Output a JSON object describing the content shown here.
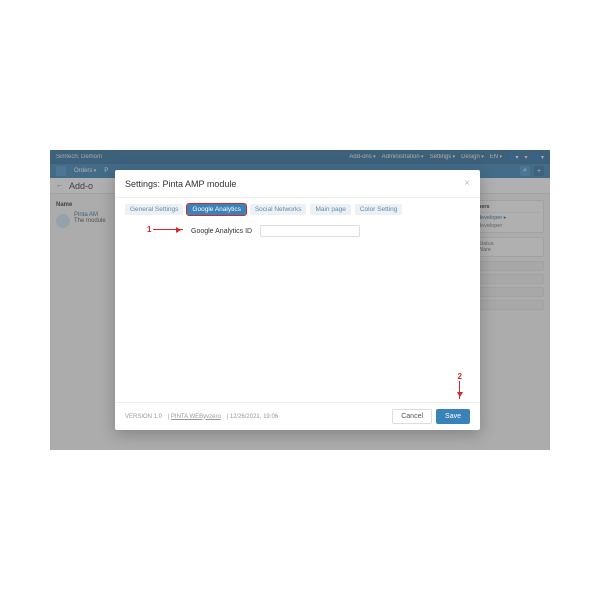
{
  "topbar": {
    "brand": "Simtech: Demo/n",
    "menu": [
      "Add-ons",
      "Administration",
      "Settings",
      "Design",
      "EN"
    ]
  },
  "subbar": {
    "items": [
      "Orders",
      "P"
    ],
    "search_icon": "search-icon",
    "plus_icon": "plus-icon"
  },
  "crumb": {
    "back": "←",
    "title": "Add-o"
  },
  "leftcol": {
    "header": "Name",
    "item_title": "Pinta AM",
    "item_desc": "The module"
  },
  "sidebar": {
    "title": "pers",
    "dev": "developer",
    "st": "Status",
    "w": "Ware"
  },
  "modal": {
    "title": "Settings: Pinta AMP module",
    "close": "×",
    "tabs": [
      "General Settings",
      "Google Analytics",
      "Social Networks",
      "Main page",
      "Color Setting"
    ],
    "active_tab": 1,
    "field_label": "Google Analytics ID",
    "field_placeholder": "",
    "callouts": {
      "first": "1",
      "second": "2"
    },
    "footer_version": "VERSION 1.0",
    "footer_vendor": "PINTA WEByvzero",
    "footer_date": "12/26/2021, 19:06",
    "cancel": "Cancel",
    "save": "Save"
  }
}
